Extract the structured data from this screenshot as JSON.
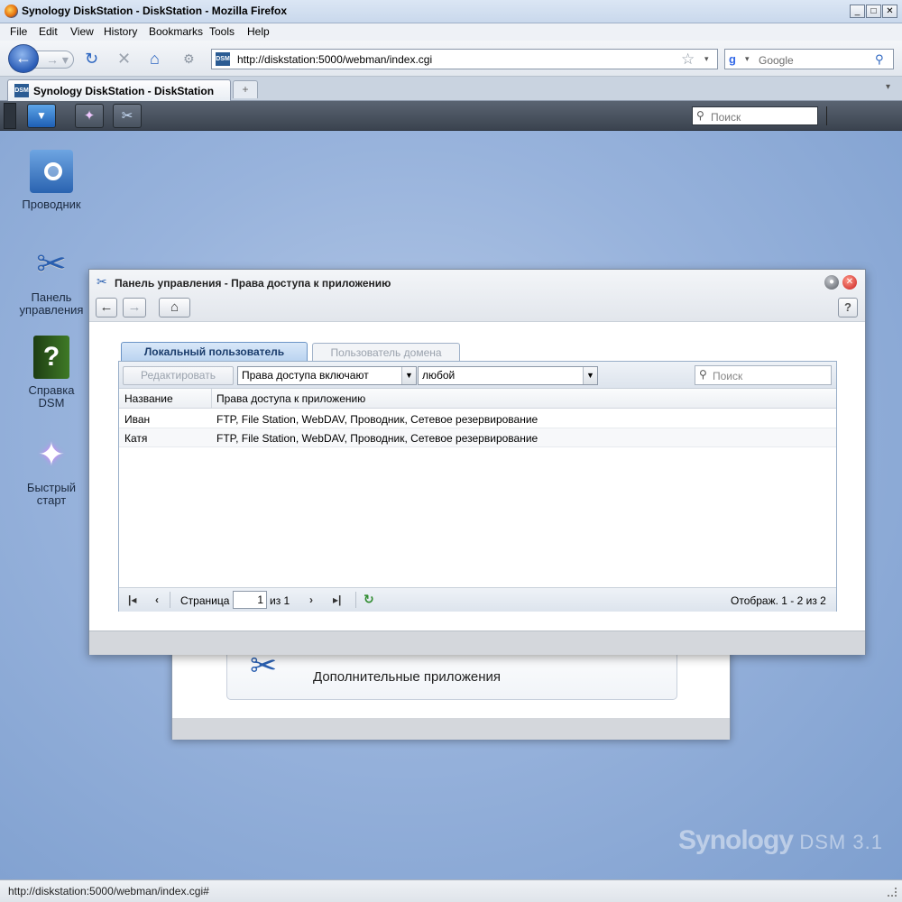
{
  "browser": {
    "title": "Synology DiskStation - DiskStation - Mozilla Firefox",
    "menu": [
      "File",
      "Edit",
      "View",
      "History",
      "Bookmarks",
      "Tools",
      "Help"
    ],
    "url": "http://diskstation:5000/webman/index.cgi",
    "search_placeholder": "Google",
    "tab_title": "Synology DiskStation - DiskStation",
    "status_url": "http://diskstation:5000/webman/index.cgi#"
  },
  "dsm": {
    "search_placeholder": "Поиск",
    "desktop_icons": [
      {
        "label": "Проводник",
        "icon": "folder-search-icon"
      },
      {
        "label": "Панель управления",
        "icon": "tools-icon"
      },
      {
        "label": "Справка DSM",
        "icon": "help-book-icon"
      },
      {
        "label": "Быстрый старт",
        "icon": "magic-wand-icon"
      }
    ],
    "logo_text": "Synology",
    "logo_suffix": "DSM 3.1"
  },
  "background_window": {
    "item_label": "Дополнительные приложения"
  },
  "window": {
    "title": "Панель управления - Права доступа к приложению",
    "tabs": [
      {
        "label": "Локальный пользователь",
        "active": true
      },
      {
        "label": "Пользователь домена",
        "active": false
      }
    ],
    "toolbar": {
      "edit_label": "Редактировать",
      "filter_select": "Права доступа включают",
      "value_select": "любой",
      "search_placeholder": "Поиск"
    },
    "table": {
      "columns": [
        "Название",
        "Права доступа к приложению"
      ],
      "rows": [
        [
          "Иван",
          "FTP, File Station, WebDAV, Проводник, Сетевое резервирование"
        ],
        [
          "Катя",
          "FTP, File Station, WebDAV, Проводник, Сетевое резервирование"
        ]
      ]
    },
    "pager": {
      "page_label": "Страница",
      "page_value": "1",
      "of_label": "из 1",
      "display_info": "Отображ. 1 - 2 из 2"
    }
  },
  "colors": {
    "accent": "#1e5fb4",
    "desktop": "#98b3dc"
  }
}
